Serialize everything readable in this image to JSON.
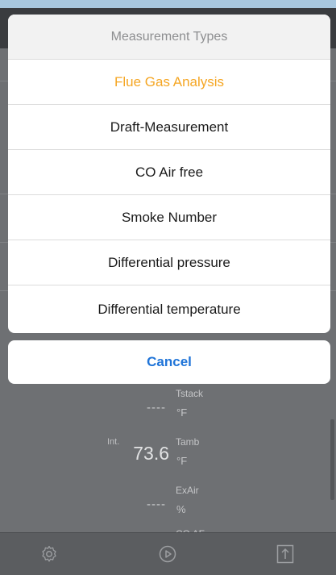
{
  "action_sheet": {
    "title": "Measurement Types",
    "items": [
      {
        "label": "Flue Gas Analysis",
        "selected": true
      },
      {
        "label": "Draft-Measurement",
        "selected": false
      },
      {
        "label": "CO Air free",
        "selected": false
      },
      {
        "label": "Smoke Number",
        "selected": false
      },
      {
        "label": "Differential pressure",
        "selected": false
      },
      {
        "label": "Differential temperature",
        "selected": false
      }
    ],
    "cancel_label": "Cancel"
  },
  "background_readings": [
    {
      "name": "Tstack",
      "value": "----",
      "unit": "°F",
      "qualifier": ""
    },
    {
      "name": "Tamb",
      "value": "73.6",
      "unit": "°F",
      "qualifier": "Int."
    },
    {
      "name": "ExAir",
      "value": "----",
      "unit": "%",
      "qualifier": ""
    },
    {
      "name": "CO AF",
      "value": "",
      "unit": "",
      "qualifier": ""
    }
  ],
  "toolbar": {
    "icons": [
      "gear-icon",
      "play-icon",
      "export-icon"
    ]
  },
  "colors": {
    "accent_selected": "#f5a623",
    "cancel_blue": "#1f74d8",
    "overlay_dim": "#6e7073"
  }
}
